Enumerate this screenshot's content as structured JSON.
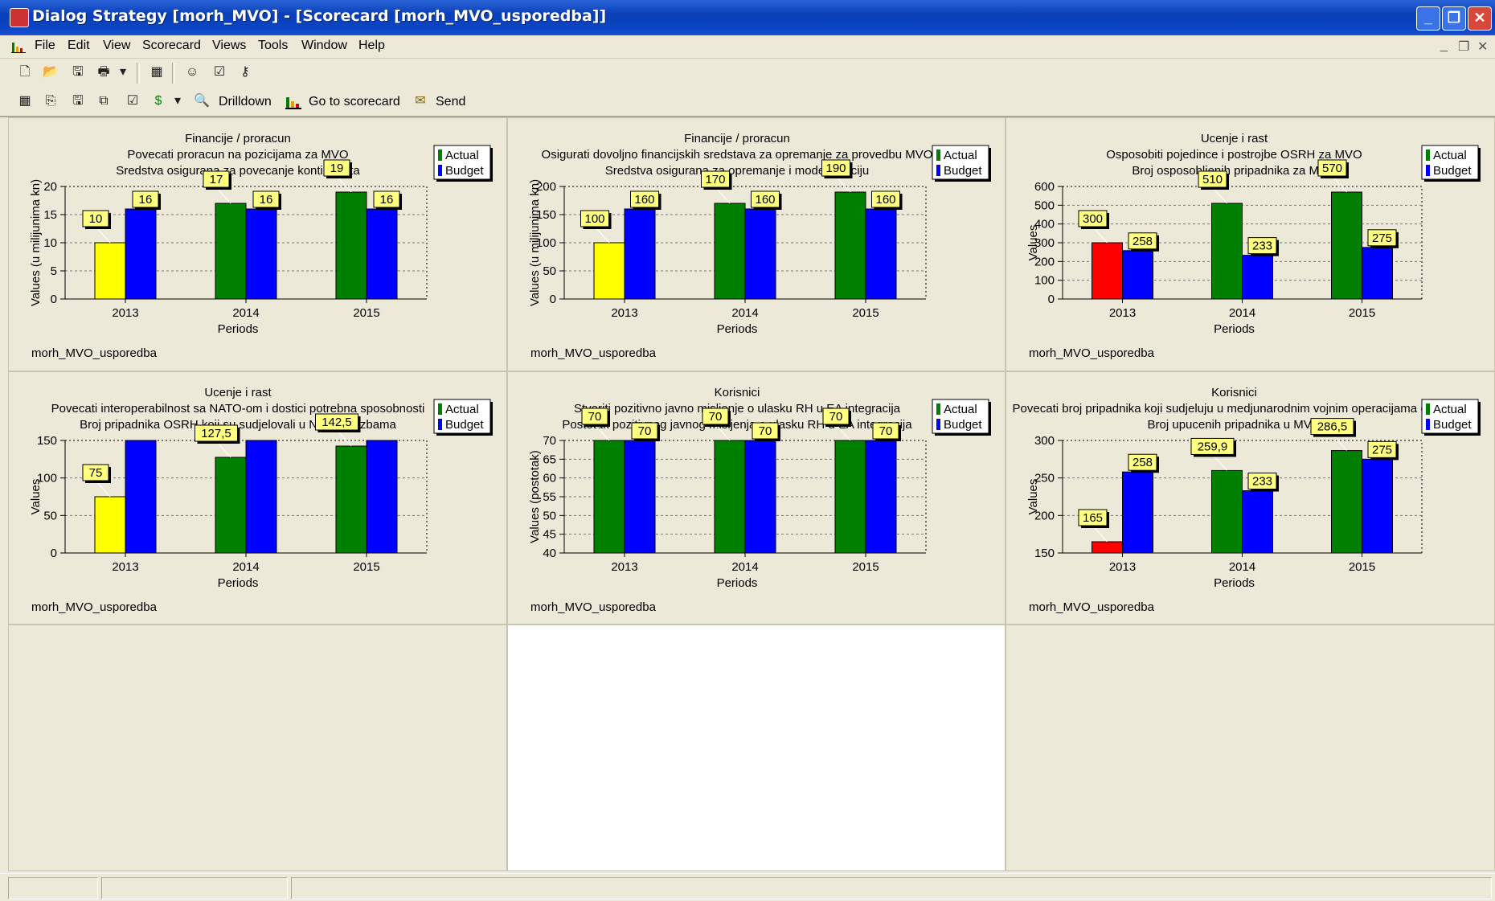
{
  "window": {
    "title": "Dialog Strategy [morh_MVO] - [Scorecard [morh_MVO_usporedba]]"
  },
  "menu": [
    "File",
    "Edit",
    "View",
    "Scorecard",
    "Views",
    "Tools",
    "Window",
    "Help"
  ],
  "toolbar2": {
    "drilldown": "Drilldown",
    "go_to_scorecard": "Go to scorecard",
    "send": "Send"
  },
  "colors": {
    "actual_default": "#008000",
    "actual_warning": "#ffff00",
    "actual_alert": "#ff0000",
    "budget": "#0000ff",
    "label_bg": "#ffff80"
  },
  "panels": [
    {
      "footer": "morh_MVO_usporedba",
      "chart_data": {
        "type": "bar",
        "title_lines": [
          "Financije / proracun",
          "Povecati proracun na pozicijama za MVO",
          "Sredstva osigurana za povecanje kontingenta"
        ],
        "ylabel": "Values (u milijunima kn)",
        "xlabel": "Periods",
        "categories": [
          "2013",
          "2014",
          "2015"
        ],
        "series": [
          {
            "name": "Actual",
            "values": [
              10,
              17,
              19
            ],
            "colors": [
              "#ffff00",
              "#008000",
              "#008000"
            ],
            "labels": [
              "10",
              "17",
              "19"
            ]
          },
          {
            "name": "Budget",
            "values": [
              16,
              16,
              16
            ],
            "colors": [
              "#0000ff",
              "#0000ff",
              "#0000ff"
            ],
            "labels": [
              "16",
              "16",
              "16"
            ]
          }
        ],
        "ylim": [
          0,
          20
        ],
        "yticks": [
          0,
          5,
          10,
          15,
          20
        ],
        "grid": true,
        "legend": "top-right"
      }
    },
    {
      "footer": "morh_MVO_usporedba",
      "chart_data": {
        "type": "bar",
        "title_lines": [
          "Financije / proracun",
          "Osigurati dovoljno financijskih sredstava za opremanje za provedbu MVO",
          "Sredstva osigurana za opremanje i modernizaciju"
        ],
        "ylabel": "Values (u milijunima kn)",
        "xlabel": "Periods",
        "categories": [
          "2013",
          "2014",
          "2015"
        ],
        "series": [
          {
            "name": "Actual",
            "values": [
              100,
              170,
              190
            ],
            "colors": [
              "#ffff00",
              "#008000",
              "#008000"
            ],
            "labels": [
              "100",
              "170",
              "190"
            ]
          },
          {
            "name": "Budget",
            "values": [
              160,
              160,
              160
            ],
            "colors": [
              "#0000ff",
              "#0000ff",
              "#0000ff"
            ],
            "labels": [
              "160",
              "160",
              "160"
            ]
          }
        ],
        "ylim": [
          0,
          200
        ],
        "yticks": [
          0,
          50,
          100,
          150,
          200
        ],
        "grid": true,
        "legend": "top-right"
      }
    },
    {
      "footer": "morh_MVO_usporedba",
      "chart_data": {
        "type": "bar",
        "title_lines": [
          "Ucenje i  rast",
          "Osposobiti pojedince i postrojbe OSRH za MVO",
          "Broj osposobljenih pripadnika za MVO"
        ],
        "ylabel": "Values",
        "xlabel": "Periods",
        "categories": [
          "2013",
          "2014",
          "2015"
        ],
        "series": [
          {
            "name": "Actual",
            "values": [
              300,
              510,
              570
            ],
            "colors": [
              "#ff0000",
              "#008000",
              "#008000"
            ],
            "labels": [
              "300",
              "510",
              "570"
            ]
          },
          {
            "name": "Budget",
            "values": [
              258,
              233,
              275
            ],
            "colors": [
              "#0000ff",
              "#0000ff",
              "#0000ff"
            ],
            "labels": [
              "258",
              "233",
              "275"
            ]
          }
        ],
        "ylim": [
          0,
          600
        ],
        "yticks": [
          0,
          100,
          200,
          300,
          400,
          500,
          600
        ],
        "grid": true,
        "legend": "top-right"
      }
    },
    {
      "footer": "morh_MVO_usporedba",
      "chart_data": {
        "type": "bar",
        "title_lines": [
          "Ucenje i  rast",
          "Povecati interoperabilnost sa NATO-om i dostici potrebna sposobnosti",
          "Broj pripadnika OSRH koji su sudjelovali u NATO vjezbama"
        ],
        "ylabel": "Values",
        "xlabel": "Periods",
        "categories": [
          "2013",
          "2014",
          "2015"
        ],
        "series": [
          {
            "name": "Actual",
            "values": [
              75,
              127.5,
              142.5
            ],
            "colors": [
              "#ffff00",
              "#008000",
              "#008000"
            ],
            "labels": [
              "75",
              "127,5",
              "142,5"
            ]
          },
          {
            "name": "Budget",
            "values": [
              150,
              150,
              150
            ],
            "colors": [
              "#0000ff",
              "#0000ff",
              "#0000ff"
            ],
            "labels": [
              "",
              "",
              ""
            ]
          }
        ],
        "ylim": [
          0,
          150
        ],
        "yticks": [
          0,
          50,
          100,
          150
        ],
        "grid": true,
        "legend": "top-right"
      }
    },
    {
      "footer": "morh_MVO_usporedba",
      "chart_data": {
        "type": "bar",
        "title_lines": [
          "Korisnici",
          "Stvoriti pozitivno javno misljenje o ulasku RH u EA integracija",
          "Postotak pozitivnog javnog misljenja o ulasku RH u EA integracija"
        ],
        "ylabel": "Values (postotak)",
        "xlabel": "Periods",
        "categories": [
          "2013",
          "2014",
          "2015"
        ],
        "series": [
          {
            "name": "Actual",
            "values": [
              70,
              70,
              70
            ],
            "colors": [
              "#008000",
              "#008000",
              "#008000"
            ],
            "labels": [
              "70",
              "70",
              "70"
            ]
          },
          {
            "name": "Budget",
            "values": [
              70,
              70,
              70
            ],
            "colors": [
              "#0000ff",
              "#0000ff",
              "#0000ff"
            ],
            "labels": [
              "70",
              "70",
              "70"
            ]
          }
        ],
        "ylim": [
          40,
          70
        ],
        "yticks": [
          40,
          45,
          50,
          55,
          60,
          65,
          70
        ],
        "grid": true,
        "legend": "top-right"
      }
    },
    {
      "footer": "morh_MVO_usporedba",
      "chart_data": {
        "type": "bar",
        "title_lines": [
          "Korisnici",
          "Povecati broj pripadnika koji sudjeluju u medjunarodnim vojnim operacijama (MVO)",
          "Broj upucenih pripadnika u MVO"
        ],
        "ylabel": "Values",
        "xlabel": "Periods",
        "categories": [
          "2013",
          "2014",
          "2015"
        ],
        "series": [
          {
            "name": "Actual",
            "values": [
              165,
              259.9,
              286.5
            ],
            "colors": [
              "#ff0000",
              "#008000",
              "#008000"
            ],
            "labels": [
              "165",
              "259,9",
              "286,5"
            ]
          },
          {
            "name": "Budget",
            "values": [
              258,
              233,
              275
            ],
            "colors": [
              "#0000ff",
              "#0000ff",
              "#0000ff"
            ],
            "labels": [
              "258",
              "233",
              "275"
            ]
          }
        ],
        "ylim": [
          150,
          300
        ],
        "yticks": [
          150,
          200,
          250,
          300
        ],
        "grid": true,
        "legend": "top-right"
      }
    }
  ]
}
